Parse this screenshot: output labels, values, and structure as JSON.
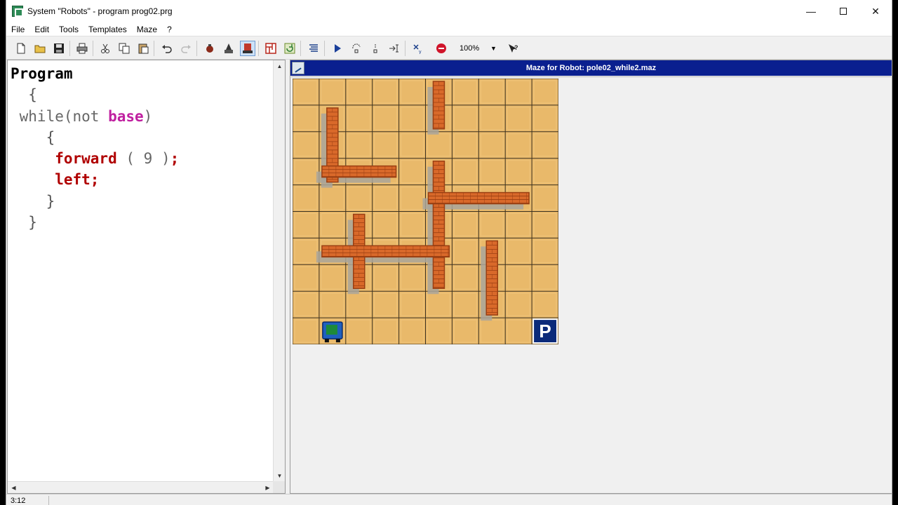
{
  "window": {
    "title": "System \"Robots\" - program prog02.prg",
    "minimize_glyph": "—",
    "close_glyph": "✕"
  },
  "menu": [
    "File",
    "Edit",
    "Tools",
    "Templates",
    "Maze",
    "?"
  ],
  "toolbar": {
    "icons": [
      "new-file-icon",
      "open-folder-icon",
      "save-icon",
      "print-icon",
      "cut-icon",
      "copy-icon",
      "paste-icon",
      "undo-icon",
      "redo-icon",
      "robot-icon",
      "wizard-icon",
      "maze-editor-icon",
      "maze-grid-icon",
      "refresh-icon",
      "align-icon",
      "run-icon",
      "step-into-icon",
      "step-over-icon",
      "step-cursor-icon",
      "breakpoint-icon",
      "stop-icon",
      "help-icon"
    ],
    "zoom": "100%"
  },
  "editor": {
    "lines": [
      [
        "Program"
      ],
      [
        "  {"
      ],
      [
        " while(not ",
        "base",
        ")"
      ],
      [
        "    {"
      ],
      [
        "     ",
        "forward",
        " ( 9 )",
        ";"
      ],
      [
        "     ",
        "left",
        ";"
      ],
      [
        "    }"
      ],
      [
        "  }"
      ]
    ]
  },
  "maze": {
    "title": "Maze for Robot: pole02_while2.maz",
    "cols": 10,
    "rows": 10,
    "base_label": "P",
    "colors": {
      "floor": "#e9b96a",
      "grid_line": "#3a3020",
      "wall": "#d9692a",
      "wall_dark": "#9a3f12",
      "shadow": "#a9a49a",
      "base_bg": "#0b2a7a"
    },
    "walls": [
      {
        "col": 5,
        "row": 0,
        "w": 1,
        "h": 2
      },
      {
        "col": 1,
        "row": 1,
        "w": 1,
        "h": 3
      },
      {
        "col": 1,
        "row": 3,
        "w": 3,
        "h": 1
      },
      {
        "col": 5,
        "row": 3,
        "w": 1,
        "h": 5
      },
      {
        "col": 5,
        "row": 4,
        "w": 4,
        "h": 1
      },
      {
        "col": 2,
        "row": 5,
        "w": 1,
        "h": 3
      },
      {
        "col": 1,
        "row": 6,
        "w": 5,
        "h": 1
      },
      {
        "col": 7,
        "row": 6,
        "w": 1,
        "h": 3
      }
    ],
    "robot": {
      "col": 1,
      "row": 9
    },
    "base": {
      "col": 9,
      "row": 9
    }
  },
  "status": {
    "cursor_pos": "3:12"
  }
}
